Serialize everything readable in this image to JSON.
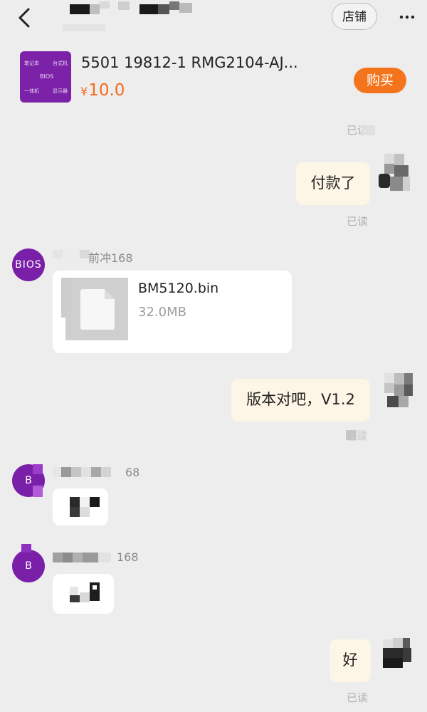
{
  "header": {
    "title": "",
    "shop_label": "店铺"
  },
  "product": {
    "title": "5501 19812-1 RMG2104-AJ...",
    "currency": "¥",
    "price": "10.0",
    "buy_label": "购买",
    "thumbnail_labels": [
      "笔记本",
      "台式机",
      "BIOS",
      "一体机",
      "显示器"
    ]
  },
  "messages": [
    {
      "direction": "out",
      "text": "付款了",
      "status": "已读"
    },
    {
      "direction": "in",
      "sender": "前冲168",
      "avatar": "BIOS",
      "file": {
        "name": "BM5120.bin",
        "size": "32.0MB"
      }
    },
    {
      "direction": "out",
      "text": "版本对吧，V1.2",
      "status": "已读"
    },
    {
      "direction": "in",
      "sender": "68",
      "avatar": "B"
    },
    {
      "direction": "in",
      "sender": "168",
      "avatar": "B"
    },
    {
      "direction": "out",
      "text": "好",
      "status": "已读"
    }
  ],
  "status_top": "已读",
  "colors": {
    "accent": "#f4741b",
    "price": "#f46a1d",
    "avatar": "#7a1fa8",
    "outgoing_bubble": "#fdf6e6",
    "background": "#ededed"
  }
}
